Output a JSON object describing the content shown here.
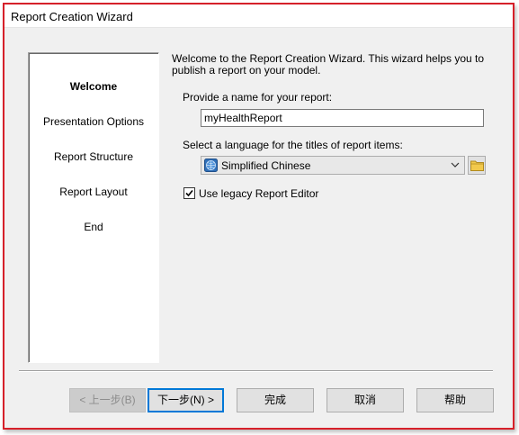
{
  "window": {
    "title": "Report Creation Wizard"
  },
  "steps": [
    {
      "label": "Welcome",
      "active": true
    },
    {
      "label": "Presentation Options",
      "active": false
    },
    {
      "label": "Report Structure",
      "active": false
    },
    {
      "label": "Report Layout",
      "active": false
    },
    {
      "label": "End",
      "active": false
    }
  ],
  "welcome": {
    "text": "Welcome to the Report Creation Wizard. This wizard helps you to publish a report on your model."
  },
  "form": {
    "name_label": "Provide a name for your report:",
    "name_value": "myHealthReport",
    "language_label": "Select a language for the titles of report items:",
    "language_value": "Simplified Chinese",
    "language_icon": "globe-icon",
    "browse_icon": "folder-icon",
    "legacy_label": "Use legacy Report Editor",
    "legacy_checked": true
  },
  "buttons": {
    "back": "< 上一步(B)",
    "next": "下一步(N) >",
    "finish": "完成",
    "cancel": "取消",
    "help": "帮助"
  },
  "colors": {
    "window_border": "#d6202a",
    "default_button_border": "#0078d7"
  }
}
